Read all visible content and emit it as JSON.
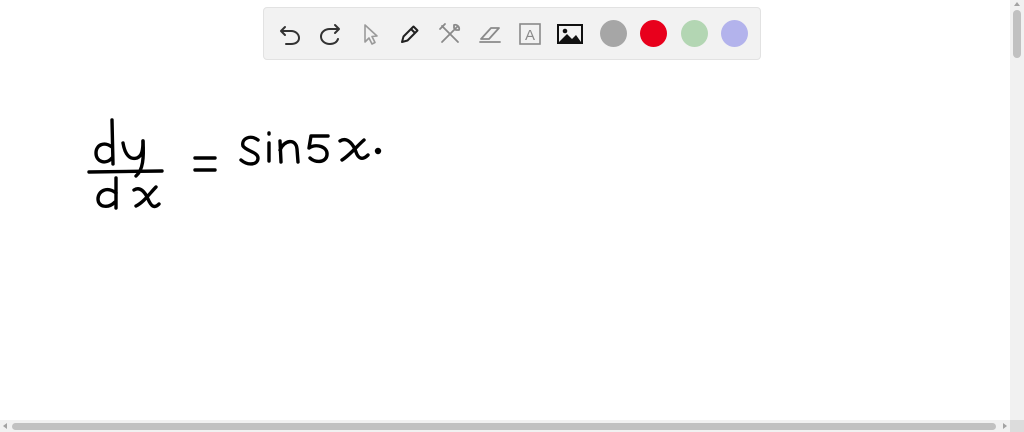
{
  "toolbar": {
    "tools": [
      {
        "name": "undo",
        "icon": "undo-icon"
      },
      {
        "name": "redo",
        "icon": "redo-icon"
      },
      {
        "name": "select",
        "icon": "pointer-icon"
      },
      {
        "name": "pen",
        "icon": "pencil-icon"
      },
      {
        "name": "tools",
        "icon": "tools-icon"
      },
      {
        "name": "eraser",
        "icon": "eraser-icon"
      },
      {
        "name": "text",
        "icon": "text-box-icon",
        "glyph": "A"
      },
      {
        "name": "image",
        "icon": "image-icon"
      }
    ],
    "colors": [
      "#a6a6a6",
      "#e8001c",
      "#b3d6b3",
      "#b3b3ec"
    ]
  },
  "canvas": {
    "handwriting": "dy/dx = sin5x."
  }
}
